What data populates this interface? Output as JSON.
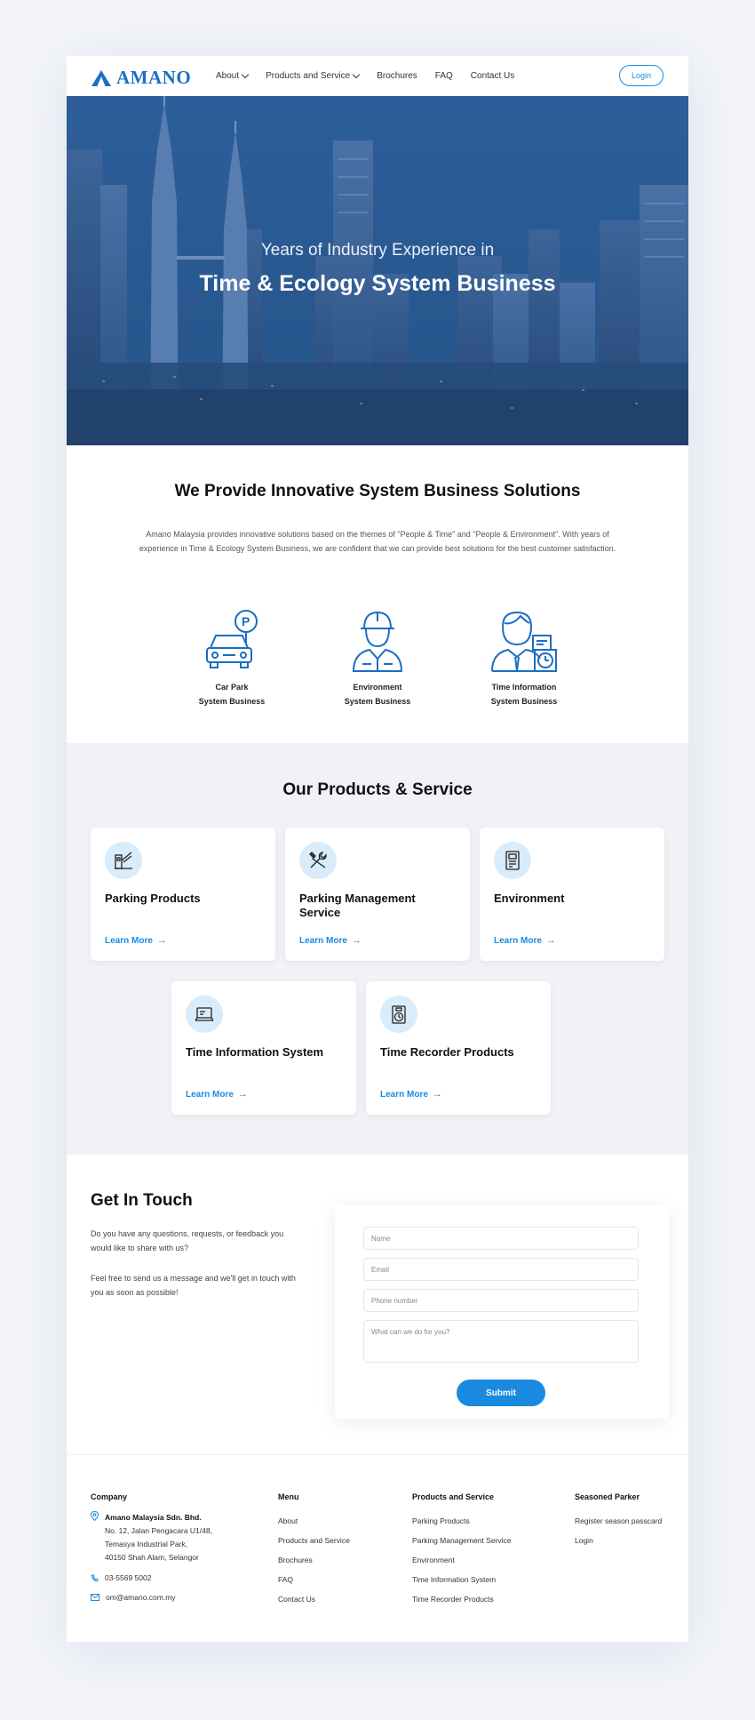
{
  "nav": {
    "logo_text": "AMANO",
    "items": [
      {
        "label": "About",
        "dropdown": true
      },
      {
        "label": "Products and Service",
        "dropdown": true
      },
      {
        "label": "Brochures",
        "dropdown": false
      },
      {
        "label": "FAQ",
        "dropdown": false
      },
      {
        "label": "Contact Us",
        "dropdown": false
      }
    ],
    "login_label": "Login"
  },
  "hero": {
    "subtitle": "Years of Industry Experience in",
    "title": "Time & Ecology System Business"
  },
  "solutions": {
    "title": "We Provide Innovative System Business Solutions",
    "description": "Amano Malaysia provides innovative solutions based on the themes of \"People & Time\" and \"People & Environment\". With years of experience in Time & Ecology System Business, we are confident that we can provide best solutions for the best customer satisfaction.",
    "items": [
      {
        "line1": "Car Park",
        "line2": "System Business",
        "icon": "car-park-icon"
      },
      {
        "line1": "Environment",
        "line2": "System Business",
        "icon": "worker-icon"
      },
      {
        "line1": "Time Information",
        "line2": "System Business",
        "icon": "office-clock-icon"
      }
    ]
  },
  "products": {
    "title": "Our Products & Service",
    "link_label": "Learn More",
    "cards": [
      {
        "title": "Parking Products",
        "icon": "barrier-gate-icon"
      },
      {
        "title": "Parking Management Service",
        "icon": "tools-icon"
      },
      {
        "title": "Environment",
        "icon": "machine-icon"
      },
      {
        "title": "Time Information System",
        "icon": "laptop-icon"
      },
      {
        "title": "Time Recorder Products",
        "icon": "time-recorder-icon"
      }
    ]
  },
  "contact": {
    "title": "Get In Touch",
    "p1": "Do you have any questions, requests, or feedback you would like to share with us?",
    "p2": "Feel free to send us a message and we'll get in touch with you as soon as possible!",
    "form": {
      "name_placeholder": "Name",
      "email_placeholder": "Email",
      "phone_placeholder": "Phone number",
      "message_placeholder": "What can we do for you?",
      "submit_label": "Submit"
    }
  },
  "footer": {
    "company": {
      "heading": "Company",
      "name": "Amano Malaysia Sdn. Bhd.",
      "address1": "No. 12, Jalan Pengacara U1/48,",
      "address2": "Temasya Industrial Park,",
      "address3": "40150 Shah Alam, Selangor",
      "phone": "03-5569 5002",
      "email": "om@amano.com.my"
    },
    "menu": {
      "heading": "Menu",
      "items": [
        "About",
        "Products and Service",
        "Brochures",
        "FAQ",
        "Contact Us"
      ]
    },
    "products": {
      "heading": "Products and Service",
      "items": [
        "Parking Products",
        "Parking Management Service",
        "Environment",
        "Time Information System",
        "Time Recorder Products"
      ]
    },
    "seasoned": {
      "heading": "Seasoned Parker",
      "items": [
        "Register season passcard",
        "Login"
      ]
    }
  },
  "colors": {
    "brand": "#1a6ec4",
    "accent": "#1a8ae0",
    "icon_bg": "#d8ecfb"
  }
}
